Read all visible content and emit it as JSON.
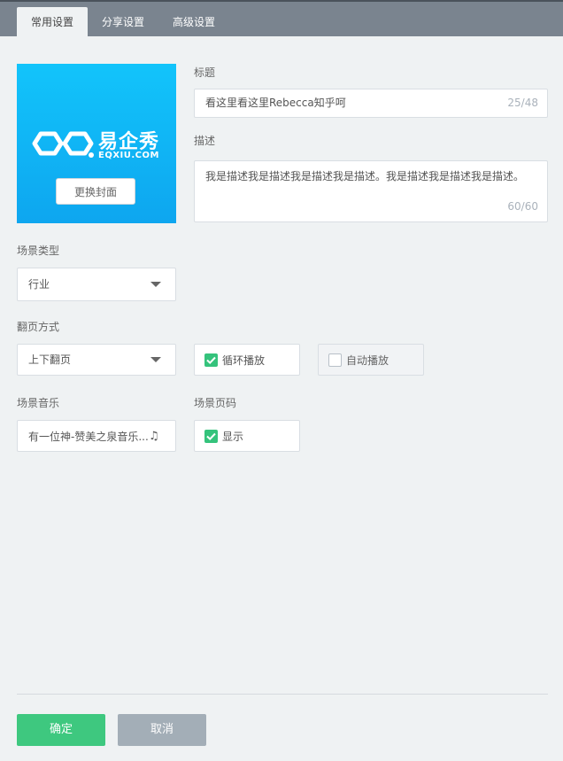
{
  "tabs": [
    {
      "label": "常用设置",
      "active": true
    },
    {
      "label": "分享设置",
      "active": false
    },
    {
      "label": "高级设置",
      "active": false
    }
  ],
  "cover": {
    "brand_cn": "易企秀",
    "brand_en": "EQXIU.COM",
    "change_button": "更换封面",
    "background_color": "#0ea6ef"
  },
  "title_field": {
    "label": "标题",
    "value": "看这里看这里Rebecca知乎呵",
    "counter": "25/48"
  },
  "description_field": {
    "label": "描述",
    "value": "我是描述我是描述我是描述我是描述。我是描述我是描述我是描述。",
    "counter": "60/60"
  },
  "scene_type": {
    "label": "场景类型",
    "selected": "行业"
  },
  "page_turn": {
    "label": "翻页方式",
    "selected": "上下翻页",
    "loop_label": "循环播放",
    "loop_checked": true,
    "autoplay_label": "自动播放",
    "autoplay_checked": false
  },
  "music": {
    "label": "场景音乐",
    "value": "有一位神-赞美之泉音乐...",
    "icon": "music-note-icon"
  },
  "page_number": {
    "label": "场景页码",
    "show_label": "显示",
    "checked": true
  },
  "footer": {
    "confirm": "确定",
    "cancel": "取消",
    "confirm_color": "#3ec87f",
    "cancel_color": "#a3aeb7"
  }
}
